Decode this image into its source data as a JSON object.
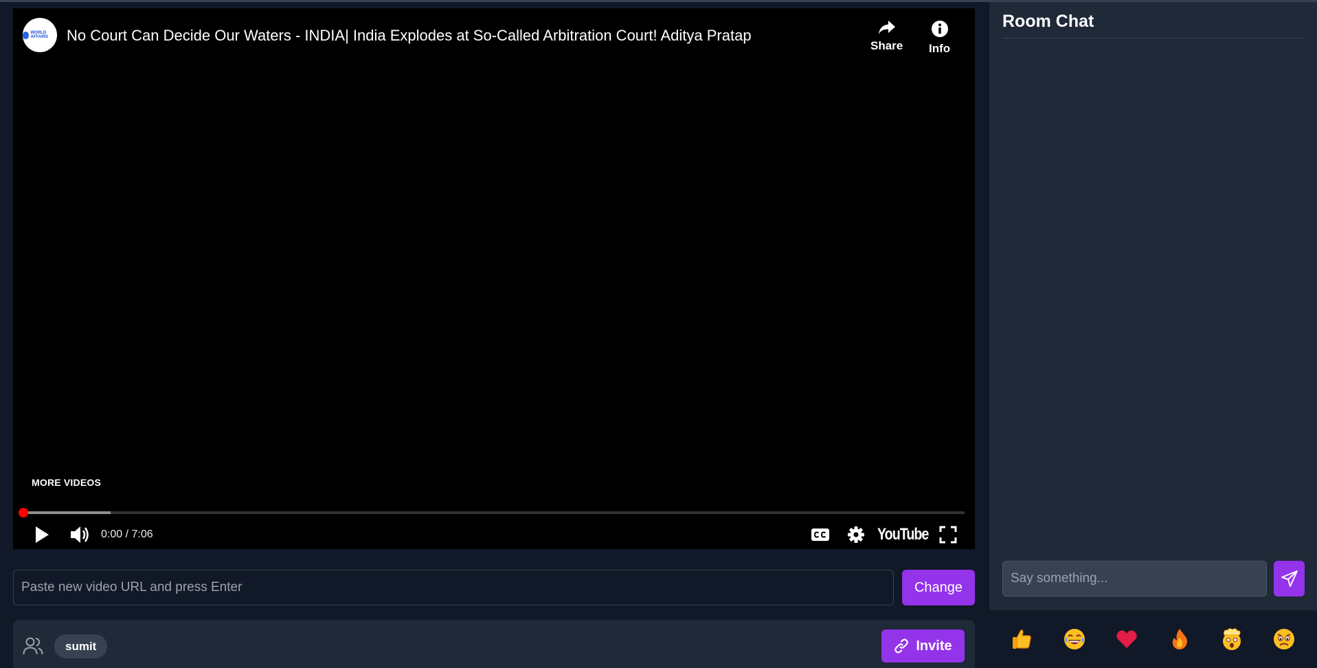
{
  "video": {
    "title": "No Court Can Decide Our Waters - INDIA| India Explodes at So-Called Arbitration Court! Aditya Pratap",
    "channel_logo_text": "WORLD AFFAIRS",
    "share_label": "Share",
    "info_label": "Info",
    "more_videos_label": "MORE VIDEOS",
    "time_display": "0:00 / 7:06",
    "played_fraction": 0.0,
    "buffered_fraction": 0.093,
    "youtube_label": "YouTube",
    "colors": {
      "progress": "#ff0000",
      "background": "#000000"
    }
  },
  "url_bar": {
    "placeholder": "Paste new video URL and press Enter",
    "value": "",
    "change_label": "Change"
  },
  "participants": {
    "users": [
      "sumit"
    ],
    "invite_label": "Invite"
  },
  "chat": {
    "title": "Room Chat",
    "messages": [],
    "input_placeholder": "Say something...",
    "input_value": ""
  },
  "reactions": [
    {
      "name": "thumbs-up-emoji"
    },
    {
      "name": "laughing-emoji"
    },
    {
      "name": "heart-emoji"
    },
    {
      "name": "fire-emoji"
    },
    {
      "name": "mind-blown-emoji"
    },
    {
      "name": "sad-emoji"
    }
  ],
  "colors": {
    "accent": "#9333ea",
    "page_bg": "#111827",
    "panel_bg": "#1f2937"
  }
}
